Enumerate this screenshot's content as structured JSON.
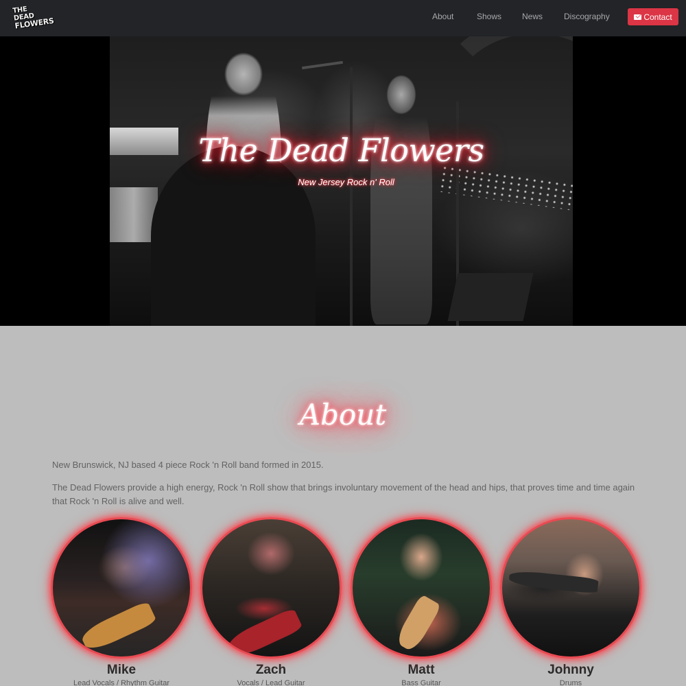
{
  "nav": {
    "logo_line1": "THE DEAD",
    "logo_line2": "FLOWERS",
    "links": [
      "About",
      "Shows",
      "News",
      "Discography"
    ],
    "contact_label": "Contact",
    "contact_icon": "envelope-icon",
    "contact_color": "#dc3545"
  },
  "hero": {
    "title": "The Dead Flowers",
    "subtitle": "New Jersey Rock n' Roll",
    "glow_color": "#ff2a3a"
  },
  "about": {
    "heading": "About",
    "paragraph1": "New Brunswick, NJ based 4 piece Rock 'n Roll band formed in 2015.",
    "paragraph2": "The Dead Flowers provide a high energy, Rock 'n Roll show that brings involuntary movement of the head and hips, that proves time and time again that Rock 'n Roll is alive and well."
  },
  "members": [
    {
      "name": "Mike",
      "role": "Lead Vocals / Rhythm Guitar"
    },
    {
      "name": "Zach",
      "role": "Vocals / Lead Guitar"
    },
    {
      "name": "Matt",
      "role": "Bass Guitar"
    },
    {
      "name": "Johnny",
      "role": "Drums"
    }
  ]
}
